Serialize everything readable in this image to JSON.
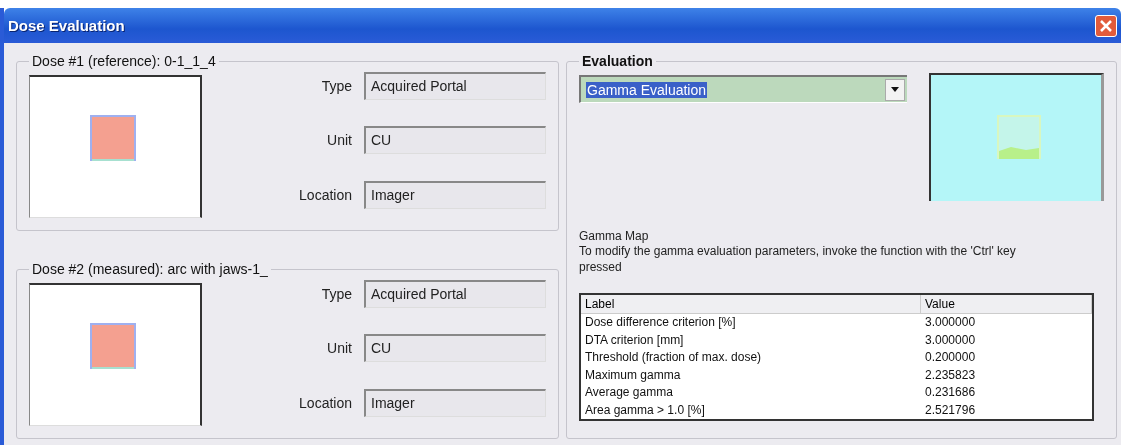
{
  "window": {
    "title": "Dose Evaluation"
  },
  "doses": [
    {
      "legend": "Dose #1 (reference): 0-1_1_4",
      "fields": [
        {
          "label": "Type",
          "value": "Acquired Portal"
        },
        {
          "label": "Unit",
          "value": "CU"
        },
        {
          "label": "Location",
          "value": "Imager"
        }
      ]
    },
    {
      "legend": "Dose #2 (measured): arc with jaws-1_",
      "fields": [
        {
          "label": "Type",
          "value": "Acquired Portal"
        },
        {
          "label": "Unit",
          "value": "CU"
        },
        {
          "label": "Location",
          "value": "Imager"
        }
      ]
    }
  ],
  "evaluation": {
    "legend": "Evaluation",
    "method": {
      "value": "Gamma Evaluation",
      "highlighted": true
    },
    "map_caption": "Gamma Map",
    "note": "To modify the gamma evaluation parameters, invoke the function with the 'Ctrl' key pressed",
    "table": {
      "columns": [
        "Label",
        "Value"
      ],
      "rows": [
        [
          "Dose difference criterion [%]",
          "3.000000"
        ],
        [
          "DTA criterion [mm]",
          "3.000000"
        ],
        [
          "Threshold (fraction of max. dose)",
          "0.200000"
        ],
        [
          "Maximum gamma",
          "2.235823"
        ],
        [
          "Average gamma",
          "0.231686"
        ],
        [
          "Area gamma > 1.0  [%]",
          "2.521796"
        ]
      ]
    }
  }
}
